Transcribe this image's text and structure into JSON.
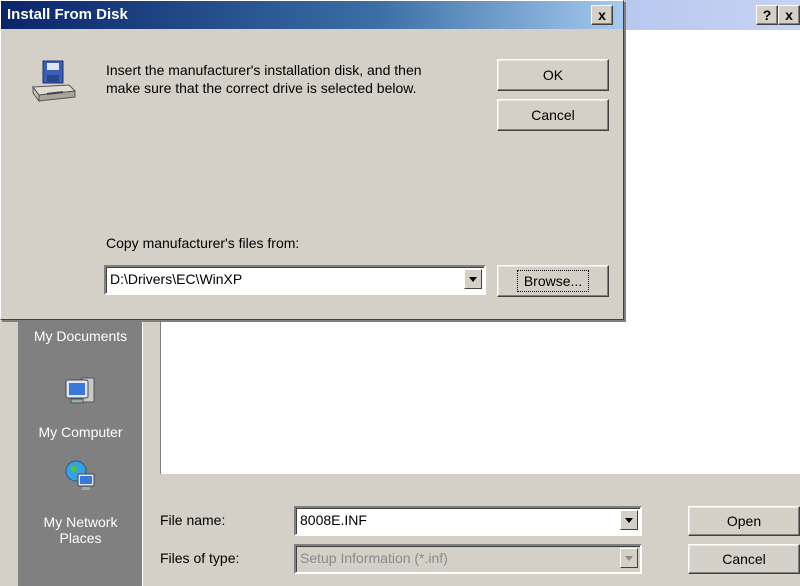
{
  "background_dialog": {
    "help_label": "?",
    "close_label": "x",
    "places": [
      {
        "label": "My Documents",
        "icon": "my-documents-icon"
      },
      {
        "label": "My Computer",
        "icon": "my-computer-icon"
      },
      {
        "label": "My Network Places",
        "icon": "network-places-icon"
      }
    ],
    "file_name_label": "File name:",
    "file_name_value": "8008E.INF",
    "files_of_type_label": "Files of type:",
    "files_of_type_value": "Setup Information (*.inf)",
    "open_label": "Open",
    "cancel_label": "Cancel"
  },
  "install_dialog": {
    "title": "Install From Disk",
    "close_label": "x",
    "instruction_line1": "Insert the manufacturer's installation disk, and then",
    "instruction_line2": "make sure that the correct drive is selected below.",
    "ok_label": "OK",
    "cancel_label": "Cancel",
    "copy_label": "Copy manufacturer's files from:",
    "copy_path": "D:\\Drivers\\EC\\WinXP",
    "browse_label": "Browse..."
  },
  "colors": {
    "title_active": "#0a246a",
    "title_inactive": "#7a96df",
    "face": "#d4d0c8",
    "places_bar": "#808080"
  }
}
